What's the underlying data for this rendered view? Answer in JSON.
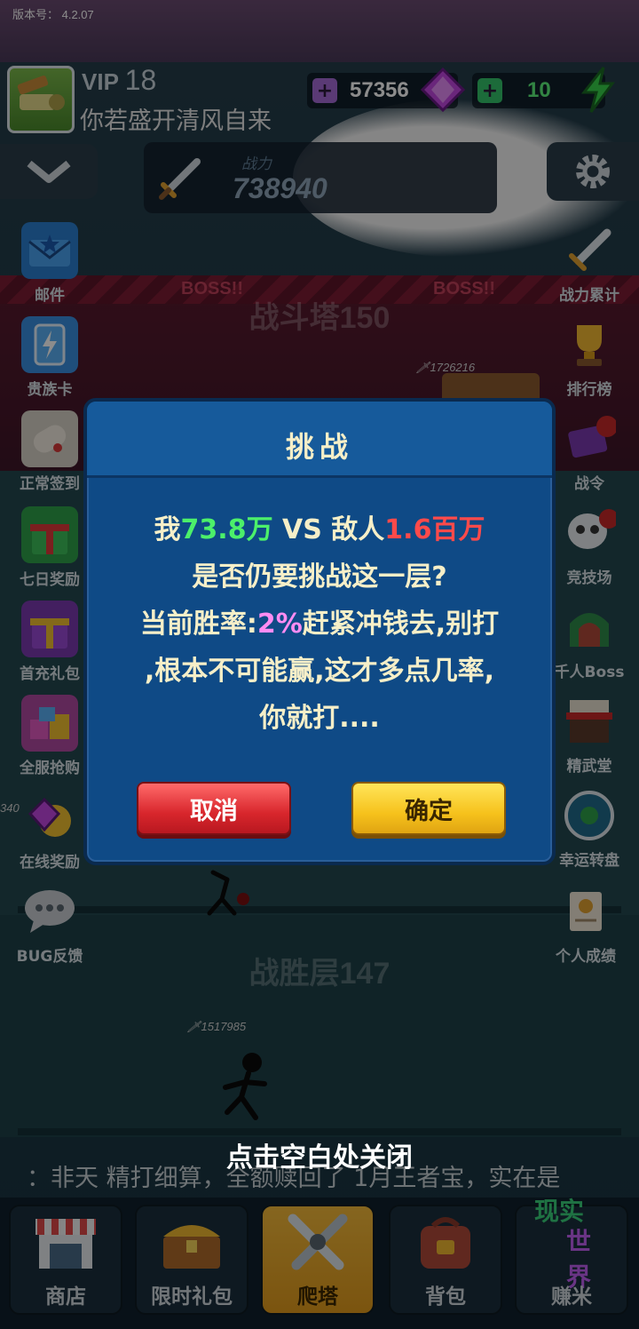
{
  "version_label": "版本号： 4.2.07",
  "player": {
    "vip_label": "VIP",
    "vip_level": "18",
    "name": "你若盛开清风自来"
  },
  "currency": {
    "gems": "57356",
    "energy": "10"
  },
  "power": {
    "label": "战力",
    "value": "738940"
  },
  "left_menu": [
    {
      "label": "邮件",
      "icon": "mail-icon"
    },
    {
      "label": "贵族卡",
      "icon": "card-icon"
    },
    {
      "label": "正常签到",
      "icon": "scroll-icon"
    },
    {
      "label": "七日奖励",
      "icon": "gift-icon"
    },
    {
      "label": "首充礼包",
      "icon": "gift-box-icon"
    },
    {
      "label": "全服抢购",
      "icon": "gift-pile-icon"
    },
    {
      "label": "在线奖励",
      "icon": "gem-icon"
    },
    {
      "label": "BUG反馈",
      "icon": "chat-icon"
    }
  ],
  "right_menu": [
    {
      "label": "战力累计",
      "icon": "sword-icon"
    },
    {
      "label": "排行榜",
      "icon": "trophy-icon"
    },
    {
      "label": "战令",
      "icon": "book-icon"
    },
    {
      "label": "竞技场",
      "icon": "skull-icon"
    },
    {
      "label": "千人Boss",
      "icon": "gate-icon"
    },
    {
      "label": "精武堂",
      "icon": "dojo-icon"
    },
    {
      "label": "幸运转盘",
      "icon": "wheel-icon"
    },
    {
      "label": "个人成绩",
      "icon": "certificate-icon"
    }
  ],
  "tower": {
    "boss_floor": "战斗塔150",
    "boss_tag": "BOSS!!",
    "boss_power": "1726216",
    "win_floor": "战胜层147",
    "player_power": "1517985",
    "partial_power": "340"
  },
  "dialog": {
    "title": "挑战",
    "line1": {
      "me": "我",
      "my_power": "73.8万",
      "vs": " VS ",
      "enemy": "敌人",
      "enemy_power": "1.6百万"
    },
    "line2": "是否仍要挑战这一层?",
    "line3": {
      "prefix": "当前胜率:",
      "rate": "2%",
      "suffix": "赶紧冲钱去,别打"
    },
    "line4": ",根本不可能赢,这才多点几率,",
    "line5": "你就打....",
    "cancel_label": "取消",
    "confirm_label": "确定"
  },
  "close_hint": "点击空白处关闭",
  "ticker": "：非天 精打细算，全额赎回了 1月王者宝，实在是",
  "bottom_nav": [
    {
      "label": "商店",
      "icon": "shop-icon"
    },
    {
      "label": "限时礼包",
      "icon": "treasure-chest-icon"
    },
    {
      "label": "爬塔",
      "icon": "crossed-swords-icon"
    },
    {
      "label": "背包",
      "icon": "backpack-icon"
    },
    {
      "label": "赚米",
      "icon": "real-world-icon",
      "badge_top": "现实",
      "badge_bottom": "世界"
    }
  ],
  "colors": {
    "dialog_bg": "#0f4a86",
    "highlight_green": "#4cf06a",
    "highlight_red": "#ff4a4a",
    "highlight_pink": "#ff8cf2",
    "cancel_red": "#d8262c",
    "confirm_yellow": "#f6c21c"
  }
}
